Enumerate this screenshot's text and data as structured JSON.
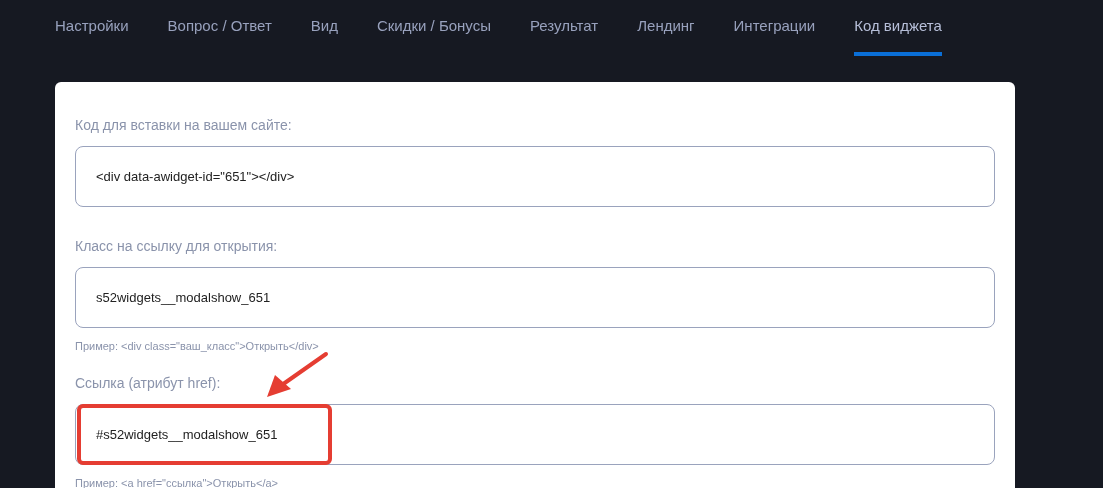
{
  "tabs": [
    {
      "label": "Настройки",
      "selected": false
    },
    {
      "label": "Вопрос / Ответ",
      "selected": false
    },
    {
      "label": "Вид",
      "selected": false
    },
    {
      "label": "Скидки / Бонусы",
      "selected": false
    },
    {
      "label": "Результат",
      "selected": false
    },
    {
      "label": "Лендинг",
      "selected": false
    },
    {
      "label": "Интеграции",
      "selected": false
    },
    {
      "label": "Код виджета",
      "selected": true
    }
  ],
  "fields": [
    {
      "label": "Код для вставки на вашем сайте:",
      "value": "<div data-awidget-id=\"651\"></div>",
      "highlighted": false
    },
    {
      "label": "Класс на ссылку для открытия:",
      "value": "s52widgets__modalshow_651",
      "hint": "Пример: <div class=\"ваш_класс\">Открыть</div>",
      "highlighted": false
    },
    {
      "label": "Ссылка (атрибут href):",
      "value": "#s52widgets__modalshow_651",
      "hint": "Пример: <a href=\"ссылка\">Открыть</a>",
      "highlighted": true
    }
  ]
}
